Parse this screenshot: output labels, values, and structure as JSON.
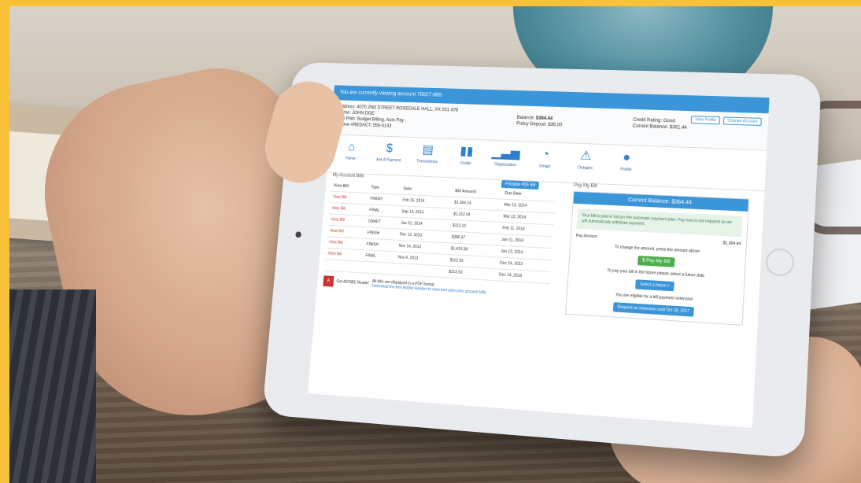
{
  "scene": {
    "colors": {
      "frame": "#f7c23a",
      "accent": "#3b95d9",
      "success": "#4cae4c"
    }
  },
  "app": {
    "banner": "You are currently viewing account 70027-885",
    "account": {
      "address_label": "Address:",
      "address_value": "4070 2ND STREET ROSEDALE HALL, XX 021 478",
      "name_label": "Name:",
      "name_value": "JOHN DOE",
      "payplan_label": "Pay Plan:",
      "payplan_value": "Budget Billing, Auto Pay",
      "phone_label": "Phone #REDACT:",
      "phone_value": "555-0143",
      "balance_label": "Balance:",
      "balance_value": "$364.44",
      "deposit_label": "Policy Deposit:",
      "deposit_value": "$35.00",
      "credit_label": "Credit Rating:",
      "credit_value": "Good",
      "current_balance_label": "Current Balance:",
      "current_balance_value": "$361.44",
      "btn_view_profile": "View Profile",
      "btn_change_account": "Change Account"
    },
    "nav": [
      {
        "label": "Home",
        "icon": "home-icon"
      },
      {
        "label": "Ask A Payment",
        "icon": "dollar-icon"
      },
      {
        "label": "Transactions",
        "icon": "transactions-icon"
      },
      {
        "label": "Usage",
        "icon": "bar-chart-icon"
      },
      {
        "label": "Organization",
        "icon": "growth-chart-icon"
      },
      {
        "label": "Usage",
        "icon": "gauge-icon"
      },
      {
        "label": "Outages",
        "icon": "warning-icon"
      },
      {
        "label": "Profile",
        "icon": "person-icon"
      }
    ],
    "bills": {
      "title": "My Account Bills",
      "print_btn": "Printable PDF Bill",
      "columns": [
        "View Bill",
        "Type",
        "Date",
        "Bill Amount",
        "Due Date"
      ],
      "rows": [
        {
          "view": "View Bill",
          "type": "FINISH",
          "date": "Feb 15, 2014",
          "amount": "$1,364.14",
          "due": "Mar 13, 2014"
        },
        {
          "view": "View Bill",
          "type": "FINAL",
          "date": "Sep 14, 2014",
          "amount": "$1,312.54",
          "due": "Mar 12, 2014"
        },
        {
          "view": "View Bill",
          "type": "DRAFT",
          "date": "Jan 21, 2014",
          "amount": "$113.22",
          "due": "Feb 11, 2014"
        },
        {
          "view": "View Bill",
          "type": "FINISH",
          "date": "Dec 12, 2013",
          "amount": "$385.47",
          "due": "Jan 11, 2014"
        },
        {
          "view": "View Bill",
          "type": "FINISH",
          "date": "Nov 14, 2013",
          "amount": "$1,410.38",
          "due": "Jan 12, 2014"
        },
        {
          "view": "View Bill",
          "type": "FINAL",
          "date": "Nov 4, 2013",
          "amount": "$112.53",
          "due": "Dec 14, 2013"
        },
        {
          "view": "",
          "type": "",
          "date": "",
          "amount": "$113.53",
          "due": "Dec 14, 2013"
        }
      ],
      "pdf_note_line1": "All bills are displayed in a PDF format.",
      "pdf_note_line2": "Download the free Adobe Reader to view and print your account bills.",
      "adobe_label": "Get ADOBE Reader"
    },
    "pay": {
      "title": "Pay My Bill",
      "header": "Current Balance: $364.44",
      "notice": "Your bill is paid in full per the automatic payment plan. Pay now is not required as we will automatically withdraw payment.",
      "pay_amount_label": "Pay Amount",
      "pay_amount_value": "$1,364.44",
      "change_text": "To change the amount, press the amount above",
      "pay_button": "$ Pay My Bill",
      "future_text": "To pay your bill in the future please select a future date",
      "select_button": "Select a future >",
      "eligible_text": "You are eligible for a bill payment extension",
      "extension_button": "Request an extension until Oct 18, 2017"
    }
  }
}
